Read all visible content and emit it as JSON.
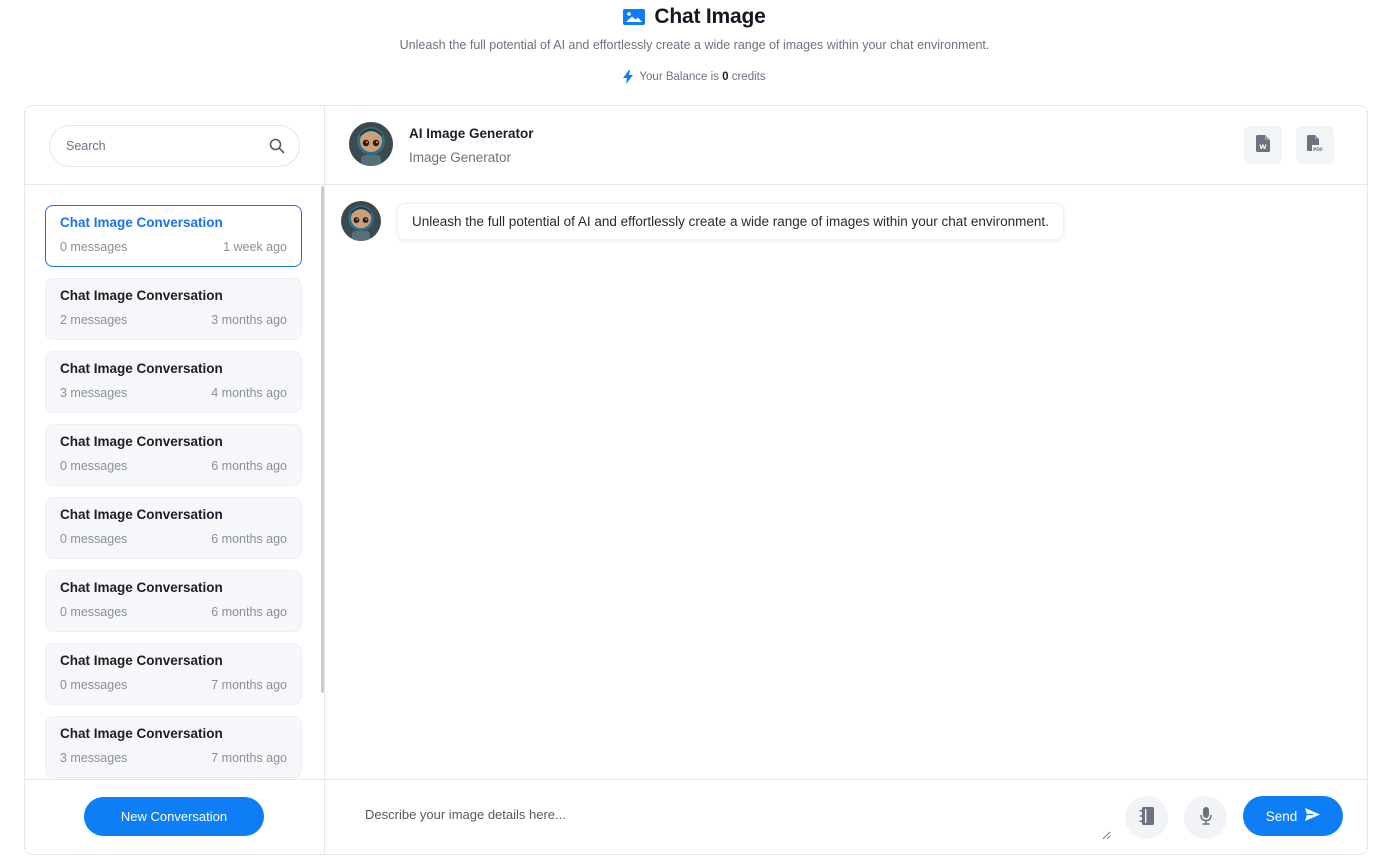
{
  "header": {
    "title": "Chat Image",
    "title_icon": "image-icon",
    "subtitle": "Unleash the full potential of AI and effortlessly create a wide range of images within your chat environment.",
    "balance_prefix": "Your Balance is",
    "balance_value": "0",
    "balance_suffix": "credits"
  },
  "sidebar": {
    "search_placeholder": "Search",
    "conversations": [
      {
        "title": "Chat Image Conversation",
        "messages": "0 messages",
        "time": "1 week ago",
        "active": true
      },
      {
        "title": "Chat Image Conversation",
        "messages": "2 messages",
        "time": "3 months ago"
      },
      {
        "title": "Chat Image Conversation",
        "messages": "3 messages",
        "time": "4 months ago"
      },
      {
        "title": "Chat Image Conversation",
        "messages": "0 messages",
        "time": "6 months ago"
      },
      {
        "title": "Chat Image Conversation",
        "messages": "0 messages",
        "time": "6 months ago"
      },
      {
        "title": "Chat Image Conversation",
        "messages": "0 messages",
        "time": "6 months ago"
      },
      {
        "title": "Chat Image Conversation",
        "messages": "0 messages",
        "time": "7 months ago"
      },
      {
        "title": "Chat Image Conversation",
        "messages": "3 messages",
        "time": "7 months ago"
      }
    ],
    "new_conversation_label": "New Conversation"
  },
  "chat": {
    "bot_name": "AI Image Generator",
    "bot_role": "Image Generator",
    "export_word_icon": "word-file-icon",
    "export_pdf_icon": "pdf-file-icon",
    "messages": [
      {
        "text": "Unleash the full potential of AI and effortlessly create a wide range of images within your chat environment."
      }
    ],
    "composer_placeholder": "Describe your image details here...",
    "send_label": "Send"
  },
  "colors": {
    "accent": "#0d7ef5",
    "active_border": "#1a73e8"
  }
}
